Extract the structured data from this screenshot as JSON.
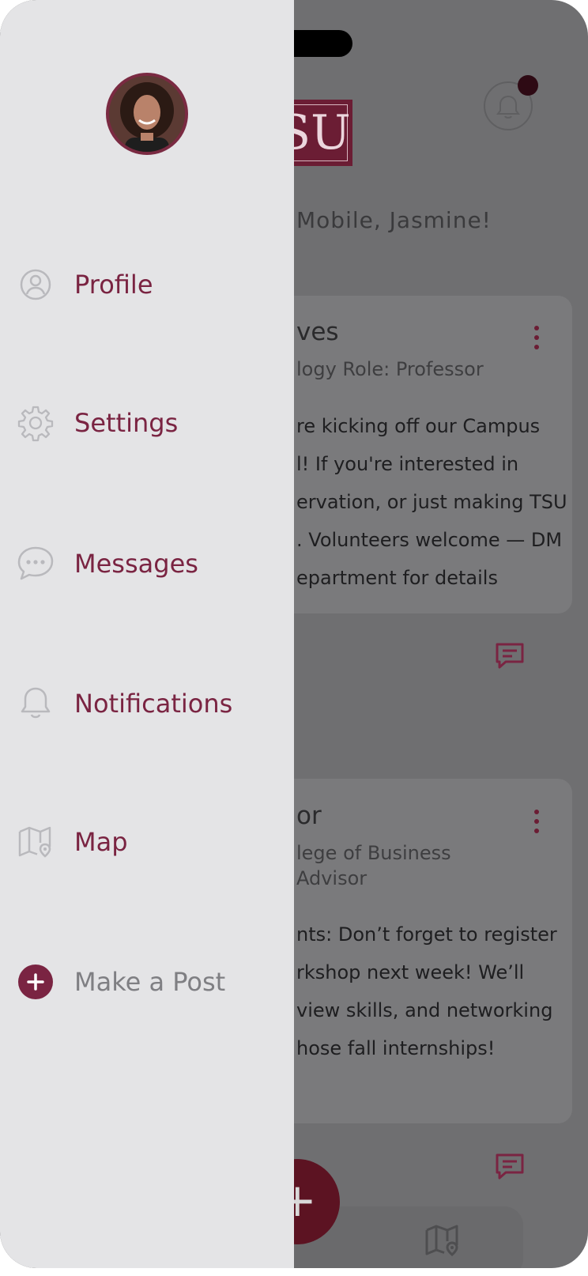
{
  "app": {
    "logo_text": "SU"
  },
  "header": {
    "welcome_text": "Mobile, Jasmine!"
  },
  "posts": [
    {
      "author": "ves",
      "meta_lines": [
        "logy Role: Professor"
      ],
      "body_lines": [
        "re kicking off our Campus",
        "l! If you're interested in",
        "ervation, or just making TSU",
        ". Volunteers welcome — DM",
        "epartment for details"
      ]
    },
    {
      "author": "or",
      "meta_lines": [
        "lege of Business",
        "Advisor"
      ],
      "body_lines": [
        "nts: Don’t forget to register",
        "rkshop next week! We’ll",
        "view skills, and networking",
        "hose fall internships!"
      ]
    }
  ],
  "drawer": {
    "items": [
      {
        "label": "Profile",
        "icon": "user-circle-icon"
      },
      {
        "label": "Settings",
        "icon": "gear-icon"
      },
      {
        "label": "Messages",
        "icon": "chat-bubble-icon"
      },
      {
        "label": "Notifications",
        "icon": "bell-icon"
      },
      {
        "label": "Map",
        "icon": "map-pin-icon"
      },
      {
        "label": "Make a Post",
        "icon": "plus-circle-icon"
      }
    ]
  },
  "fab": {
    "label": "+"
  },
  "colors": {
    "brand": "#7a2442",
    "drawer_bg": "#e4e4e6",
    "overlay": "#6f6f71",
    "muted_text": "#7f7f83"
  }
}
